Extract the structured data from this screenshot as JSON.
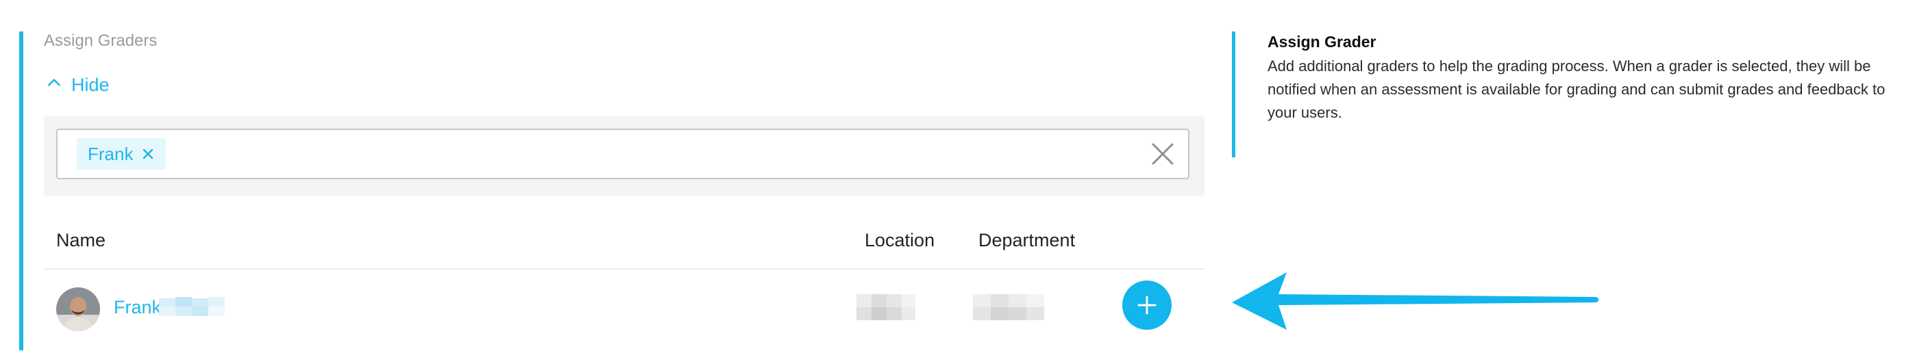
{
  "section": {
    "label": "Assign Graders",
    "hide_label": "Hide"
  },
  "picker": {
    "selected_chip": "Frank"
  },
  "table": {
    "headers": {
      "name": "Name",
      "location": "Location",
      "department": "Department"
    },
    "rows": [
      {
        "name": "Frank"
      }
    ]
  },
  "info": {
    "title": "Assign Grader",
    "body": "Add additional graders to help the grading process. When a grader is selected, they will be notified when an assessment is available for grading and can submit grades and feedback to your users."
  },
  "colors": {
    "accent": "#1fb7e8",
    "button": "#12b5ec",
    "annotation_arrow": "#12b5ec"
  },
  "icons": [
    "chevron-up-icon",
    "close-icon",
    "plus-icon",
    "arrow-annotation"
  ]
}
